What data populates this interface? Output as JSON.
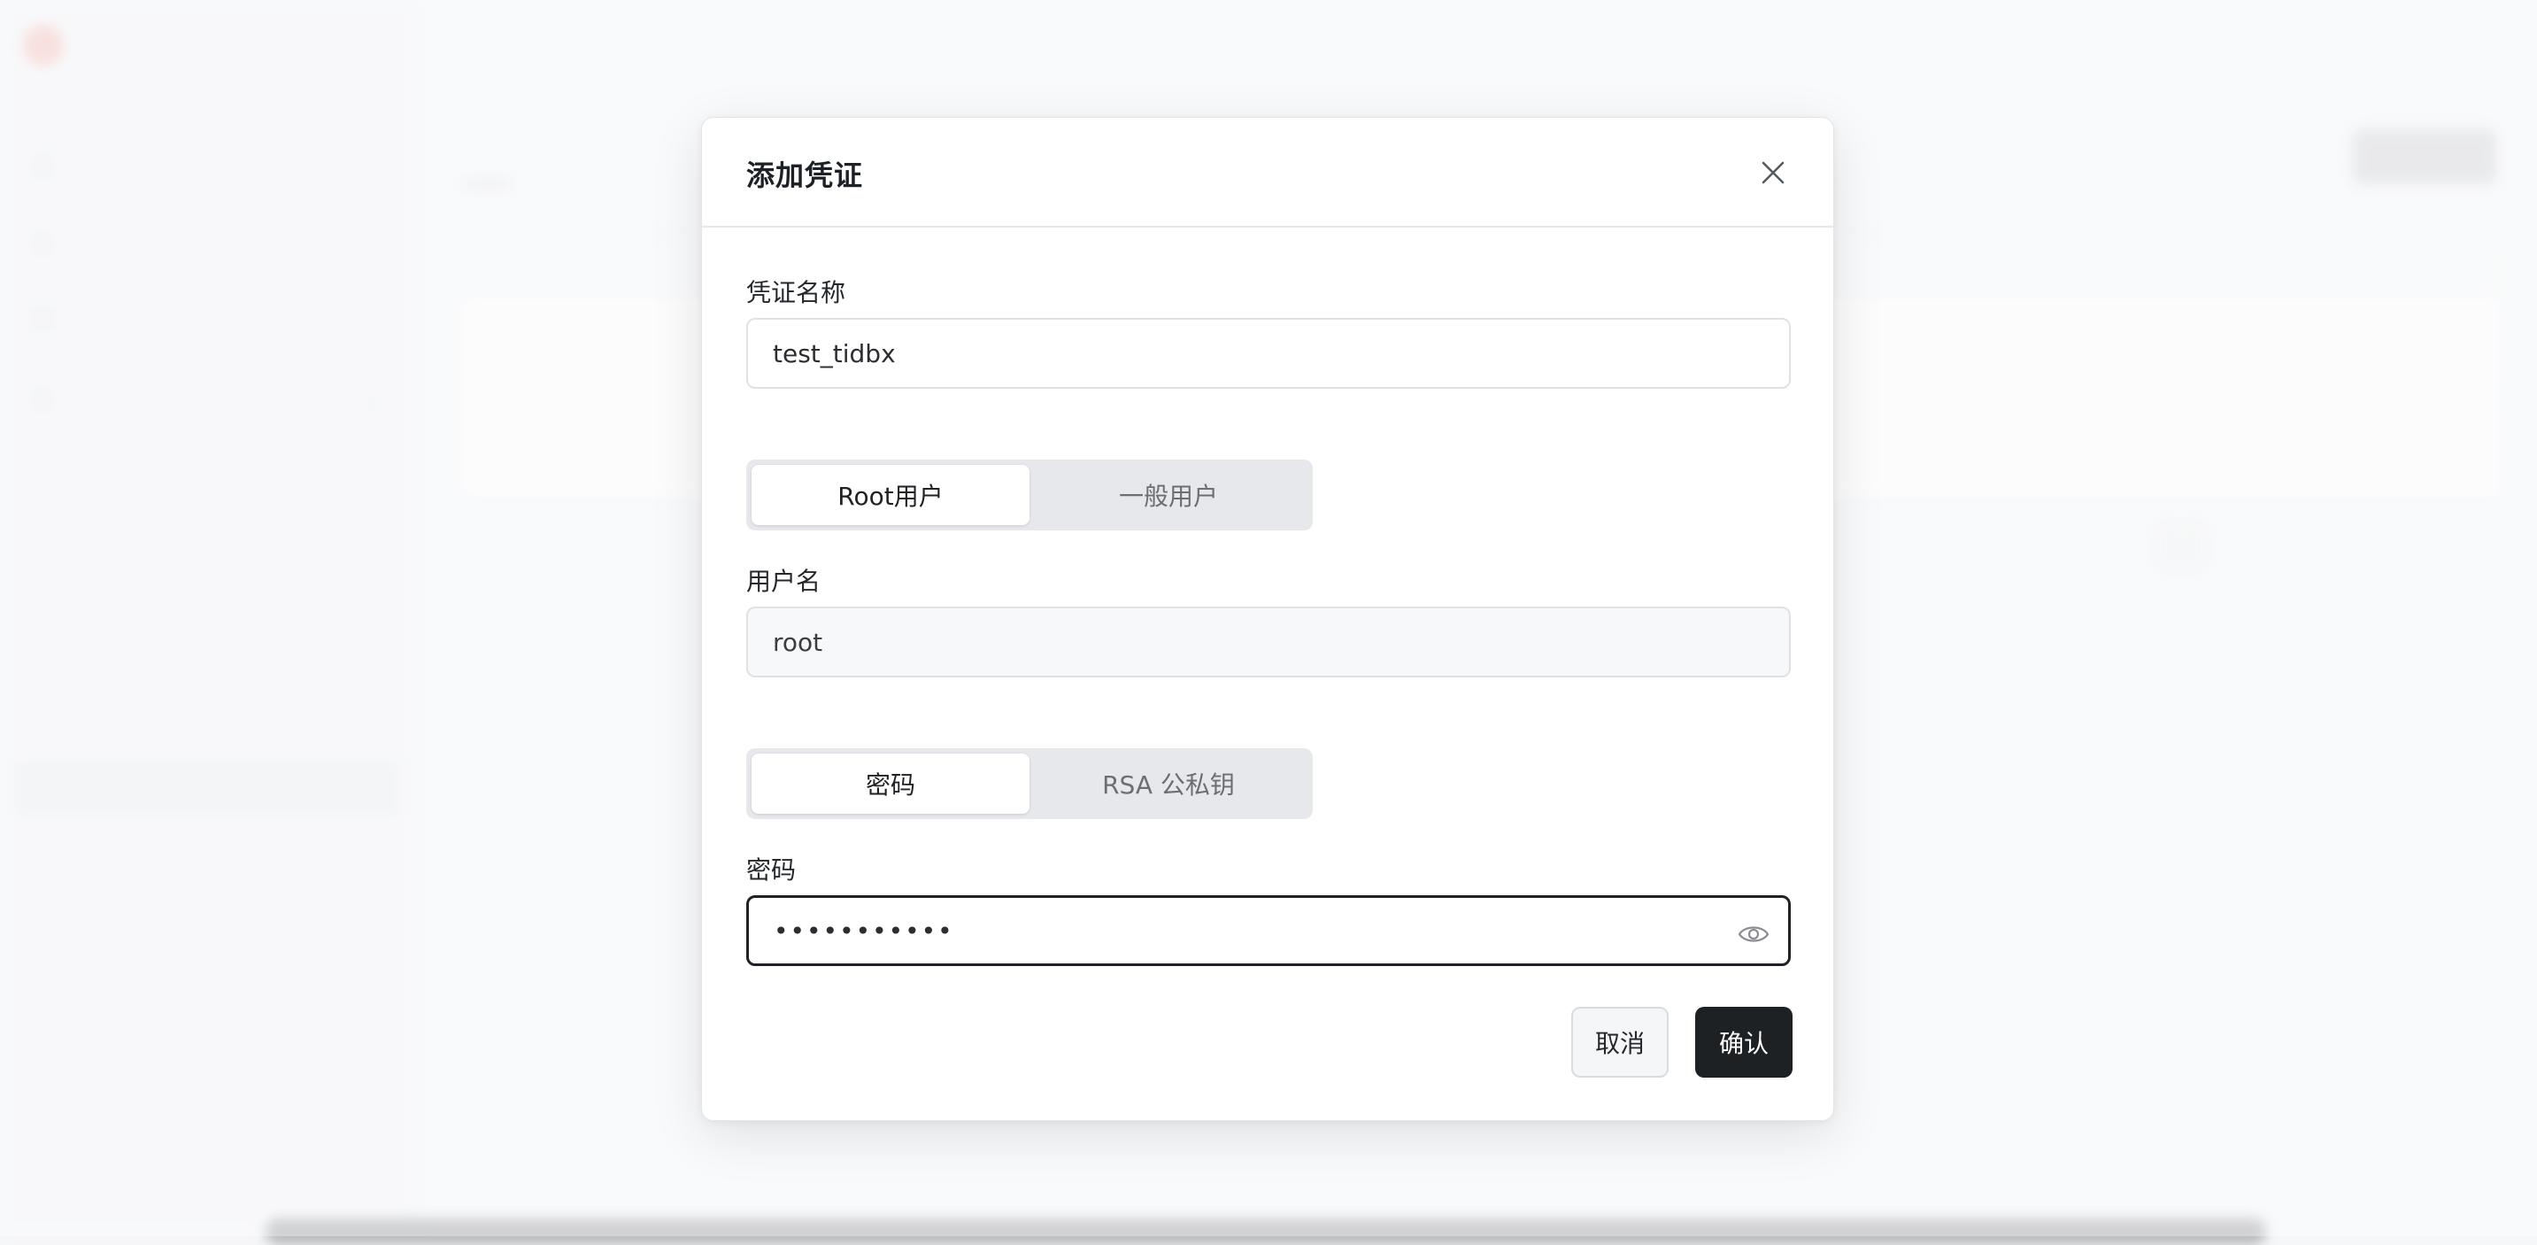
{
  "modal": {
    "title": "添加凭证",
    "credential_name": {
      "label": "凭证名称",
      "value": "test_tidbx"
    },
    "user_type": {
      "options": [
        "Root用户",
        "一般用户"
      ],
      "selected": "Root用户"
    },
    "username": {
      "label": "用户名",
      "value": "root"
    },
    "auth_type": {
      "options": [
        "密码",
        "RSA 公私钥"
      ],
      "selected": "密码"
    },
    "password": {
      "label": "密码",
      "value": "•••••••••••"
    },
    "actions": {
      "cancel": "取消",
      "confirm": "确认"
    }
  },
  "colors": {
    "primary_button": "#1e2124",
    "focus_border": "#1f2124",
    "segment_track": "#e6e8eb"
  },
  "icons": {
    "close": "close-icon",
    "password_toggle": "eye-icon"
  }
}
